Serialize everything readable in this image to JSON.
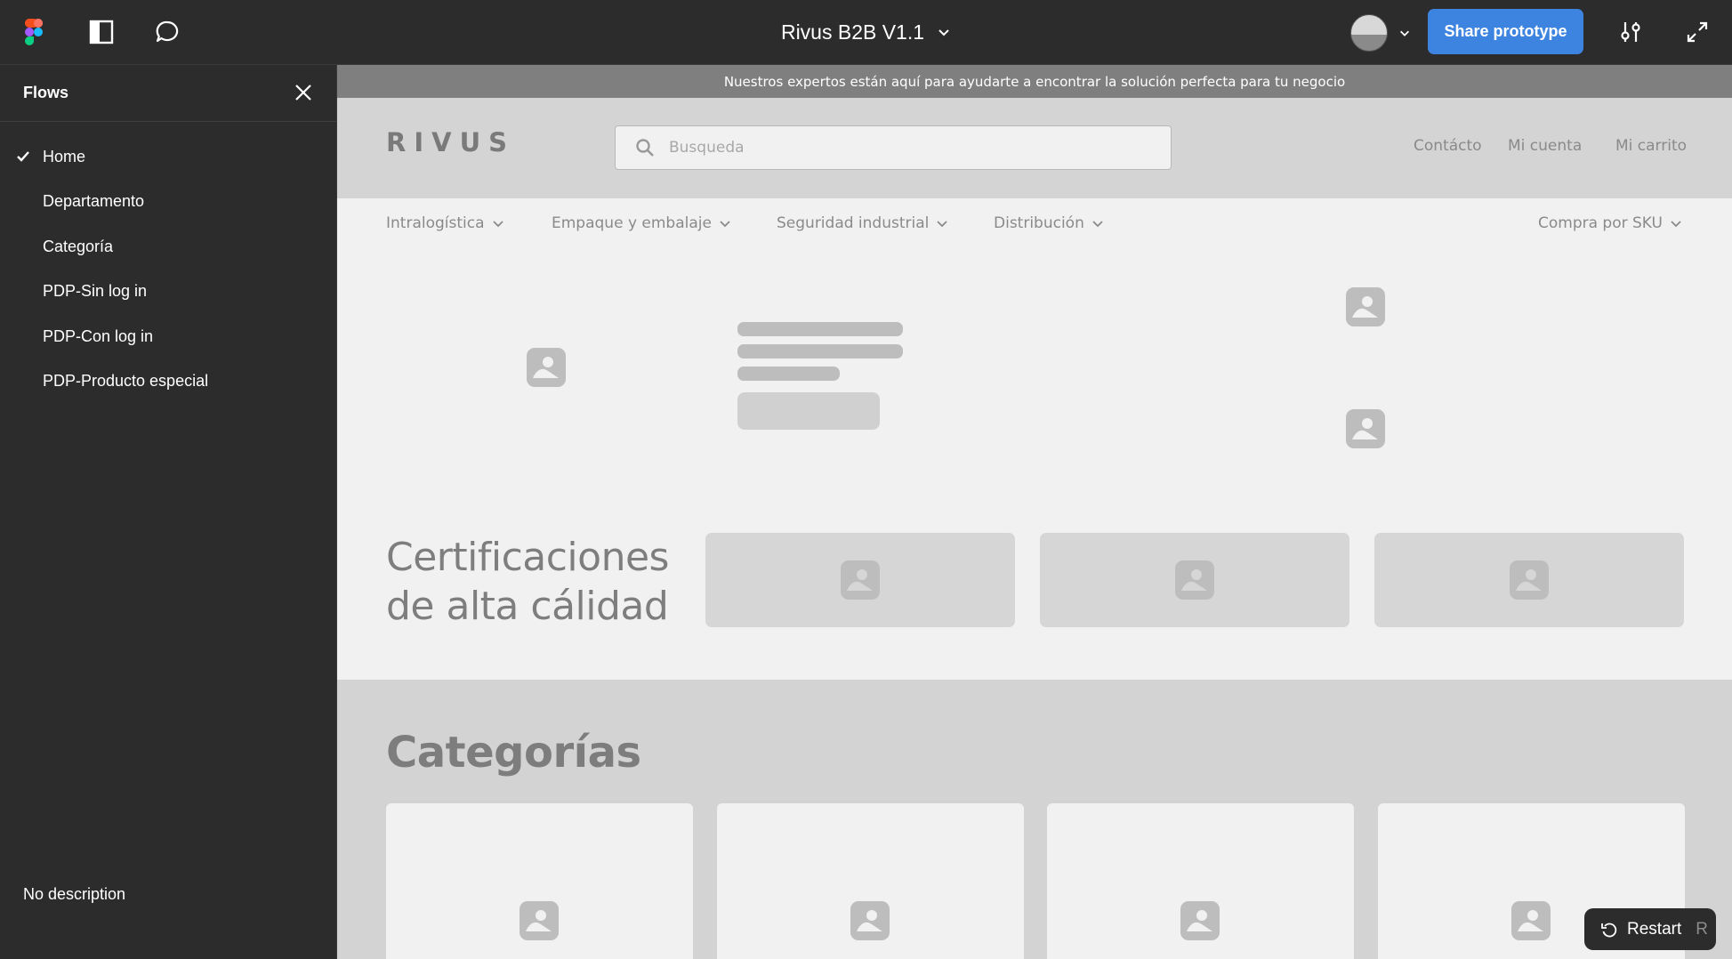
{
  "app": {
    "document_title": "Rivus B2B V1.1",
    "share_button": "Share prototype",
    "icons": {
      "figma": "figma-logo-icon",
      "sidebar_toggle": "sidebar-panel-icon",
      "comments": "comment-bubble-icon",
      "settings": "sliders-icon",
      "expand": "expand-arrows-icon"
    },
    "colors": {
      "chrome": "#2c2c2c",
      "share": "#3d84e0"
    }
  },
  "sidebar": {
    "title": "Flows",
    "items": [
      {
        "label": "Home",
        "selected": true
      },
      {
        "label": "Departamento",
        "selected": false
      },
      {
        "label": "Categoría",
        "selected": false
      },
      {
        "label": "PDP-Sin log in",
        "selected": false
      },
      {
        "label": "PDP-Con log in",
        "selected": false
      },
      {
        "label": "PDP-Producto especial",
        "selected": false
      }
    ],
    "description": "No description"
  },
  "prototype": {
    "announcement": "Nuestros expertos están aquí para ayudarte a encontrar la solución perfecta para tu negocio",
    "header": {
      "logo_text": "RIVUS",
      "search_placeholder": "Busqueda",
      "links": [
        "Contácto",
        "Mi cuenta",
        "Mi carrito"
      ]
    },
    "nav": {
      "categories": [
        "Intralogística",
        "Empaque y embalaje",
        "Seguridad industrial",
        "Distribución"
      ],
      "sku": "Compra por SKU"
    },
    "certifications": {
      "title_line1": "Certificaciones",
      "title_line2": "de alta cálidad"
    },
    "categories_section": {
      "title": "Categorías"
    }
  },
  "restart": {
    "label": "Restart",
    "shortcut": "R"
  }
}
